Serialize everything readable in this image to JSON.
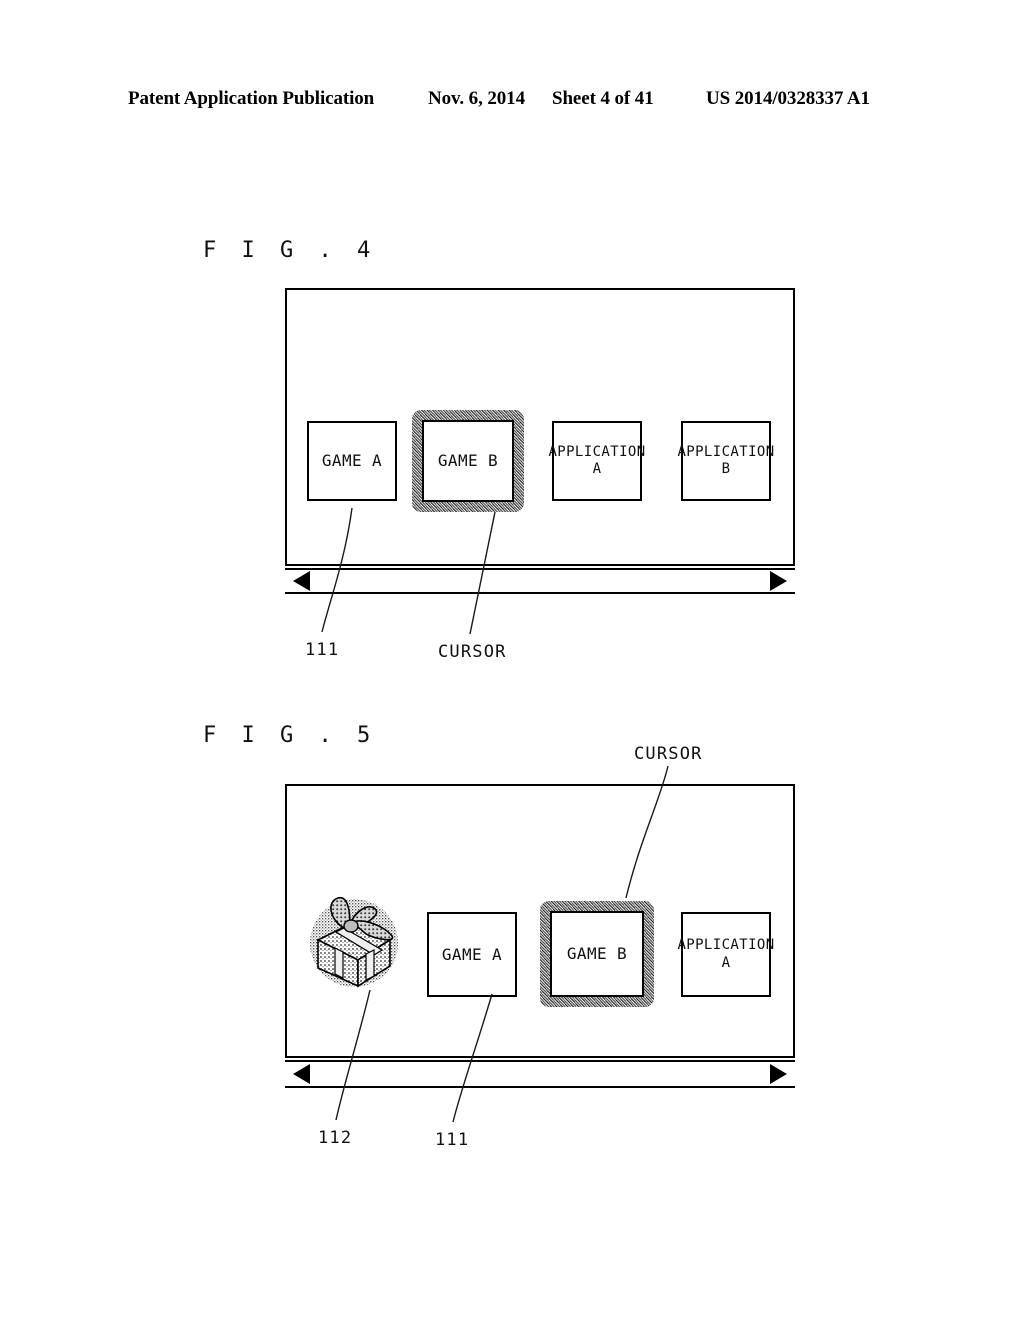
{
  "header": {
    "publication": "Patent Application Publication",
    "date": "Nov. 6, 2014",
    "sheet": "Sheet 4 of 41",
    "patent_number": "US 2014/0328337 A1"
  },
  "figures": [
    {
      "id": "fig4",
      "label": "F I G .  4",
      "icons": [
        {
          "name": "game-a",
          "label": "GAME A",
          "selected": false
        },
        {
          "name": "game-b",
          "label": "GAME B",
          "selected": true
        },
        {
          "name": "application-a",
          "label": "APPLICATION\nA",
          "selected": false
        },
        {
          "name": "application-b",
          "label": "APPLICATION\nB",
          "selected": false
        }
      ],
      "scrollbar": {
        "left_arrow_icon": "triangle-left-icon",
        "right_arrow_icon": "triangle-right-icon"
      },
      "annotations": [
        {
          "name": "ref-111",
          "text": "111"
        },
        {
          "name": "ref-cursor",
          "text": "CURSOR"
        }
      ]
    },
    {
      "id": "fig5",
      "label": "F I G .  5",
      "gift_icon": {
        "name": "gift-box-icon",
        "label": ""
      },
      "icons": [
        {
          "name": "game-a",
          "label": "GAME A",
          "selected": false
        },
        {
          "name": "game-b",
          "label": "GAME B",
          "selected": true
        },
        {
          "name": "application-a",
          "label": "APPLICATION\nA",
          "selected": false
        }
      ],
      "scrollbar": {
        "left_arrow_icon": "triangle-left-icon",
        "right_arrow_icon": "triangle-right-icon"
      },
      "annotations": [
        {
          "name": "ref-cursor",
          "text": "CURSOR"
        },
        {
          "name": "ref-112",
          "text": "112"
        },
        {
          "name": "ref-111",
          "text": "111"
        }
      ]
    }
  ]
}
